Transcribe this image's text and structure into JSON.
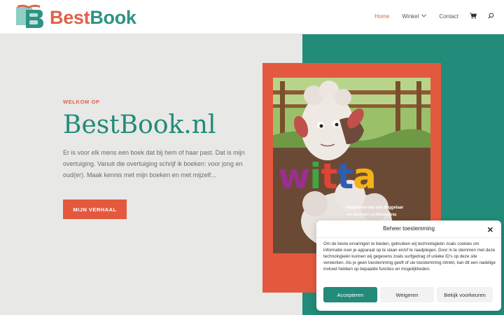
{
  "brand": {
    "part1": "Best",
    "part2": "Book",
    "color_primary": "#e0614a",
    "color_secondary": "#2e9384"
  },
  "nav": {
    "items": [
      {
        "label": "Home",
        "active": true
      },
      {
        "label": "Winkel",
        "dropdown": true
      },
      {
        "label": "Contact"
      }
    ],
    "cart_icon": "cart-icon",
    "search_icon": "search-icon"
  },
  "hero": {
    "welcome": "WELKOM OP",
    "title": "BestBook.nl",
    "intro": "Er is voor elk mens een boek dat bij hem of haar past. Dat is mijn overtuiging. Vanuit die overtuiging schrijf ik boeken: voor jong en oud(er). Maak kennis met mijn boeken en met mijzelf...",
    "cta": "MIJN VERHAAL"
  },
  "book_cover": {
    "title": "witta",
    "author": "Hubertine van den Biggelaar",
    "illustrations_prefix": "met illustraties van",
    "illustrator": "Bianca Snip"
  },
  "cookie": {
    "title": "Beheer toestemming",
    "text": "Om de beste ervaringen te bieden, gebruiken wij technologieën zoals cookies om informatie over je apparaat op te slaan en/of te raadplegen. Door in te stemmen met deze technologieën kunnen wij gegevens zoals surfgedrag of unieke ID's op deze site verwerken. Als je geen toestemming geeft of uw toestemming intrekt, kan dit een nadelige invloed hebben op bepaalde functies en mogelijkheden.",
    "accept": "Accepteren",
    "deny": "Weigeren",
    "prefs": "Bekijk voorkeuren"
  },
  "colors": {
    "teal": "#228b79",
    "coral": "#e3593e",
    "background": "#e8e8e6"
  }
}
